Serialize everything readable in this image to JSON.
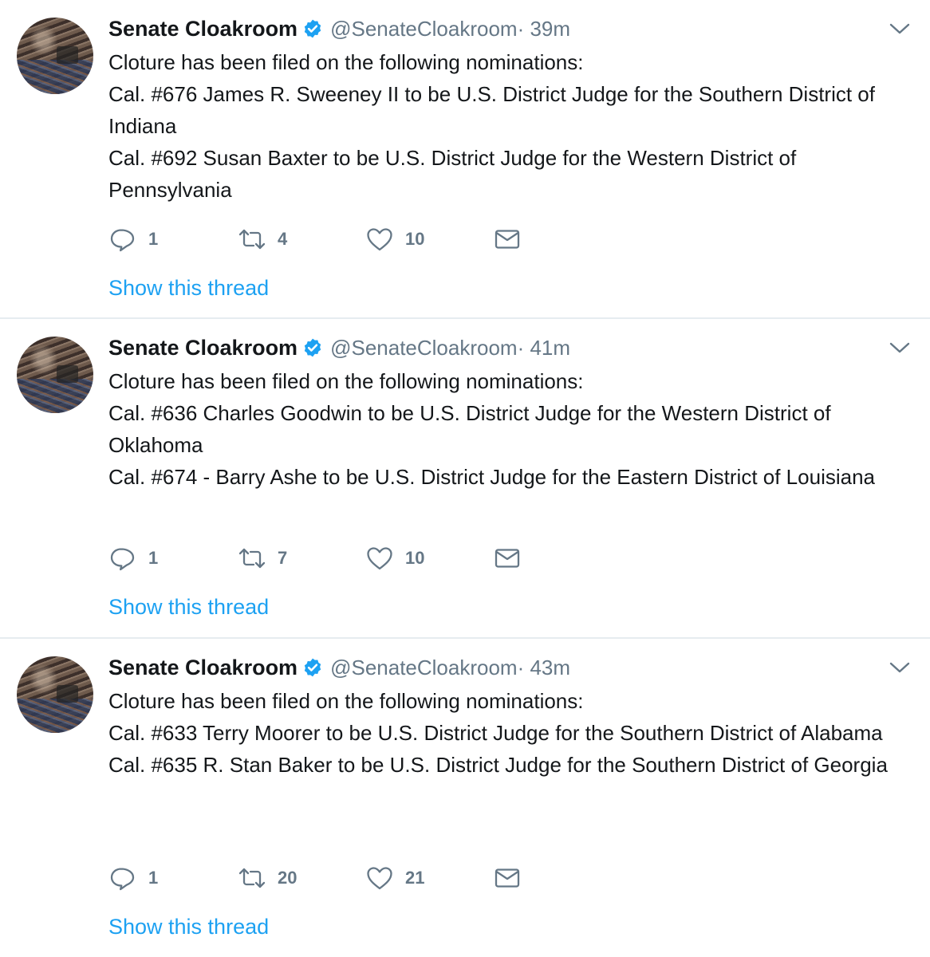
{
  "tweets": [
    {
      "author_name": "Senate Cloakroom",
      "handle": "@SenateCloakroom",
      "time": "· 39m",
      "lines": [
        "Cloture has been filed on the following nominations:",
        "Cal. #676 James R. Sweeney II to be U.S. District Judge for the Southern District of Indiana",
        "Cal. #692 Susan Baxter to be U.S. District Judge for the Western District of Pennsylvania"
      ],
      "replies": "1",
      "retweets": "4",
      "likes": "10",
      "show_thread": "Show this thread"
    },
    {
      "author_name": "Senate Cloakroom",
      "handle": "@SenateCloakroom",
      "time": "· 41m",
      "lines": [
        "Cloture has been filed on the following nominations:",
        "Cal. #636 Charles Goodwin to be U.S. District Judge for the Western District of Oklahoma",
        "Cal. #674 - Barry Ashe to be U.S. District Judge for the Eastern District of Louisiana"
      ],
      "replies": "1",
      "retweets": "7",
      "likes": "10",
      "show_thread": "Show this thread"
    },
    {
      "author_name": "Senate Cloakroom",
      "handle": "@SenateCloakroom",
      "time": "· 43m",
      "lines": [
        "Cloture has been filed on the following nominations:",
        "Cal. #633 Terry Moorer to be U.S. District Judge for the Southern District of Alabama",
        "Cal. #635 R. Stan Baker to be U.S. District Judge for the Southern District of Georgia"
      ],
      "replies": "1",
      "retweets": "20",
      "likes": "21",
      "show_thread": "Show this thread"
    }
  ],
  "icons": {
    "verified": "verified-badge-icon",
    "caret": "chevron-down-icon",
    "reply": "reply-icon",
    "retweet": "retweet-icon",
    "like": "heart-icon",
    "dm": "envelope-icon"
  },
  "colors": {
    "accent": "#1da1f2",
    "muted": "#657786",
    "text": "#14171a",
    "divider": "#e6ecf0"
  }
}
